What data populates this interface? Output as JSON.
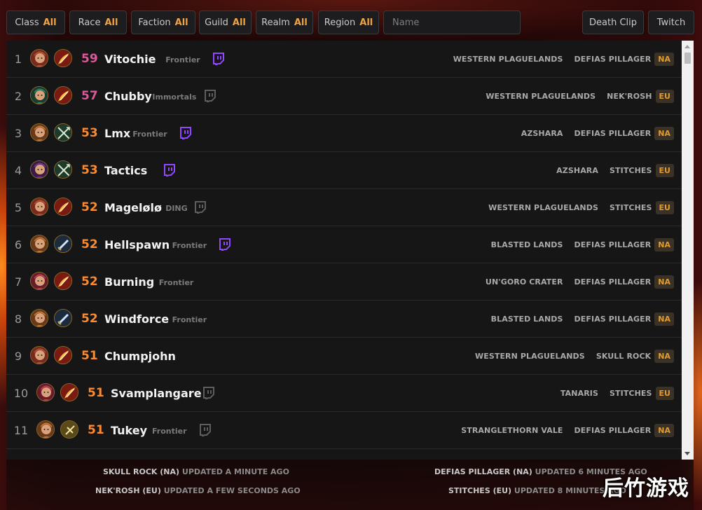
{
  "filters": {
    "class": {
      "label": "Class",
      "value": "All"
    },
    "race": {
      "label": "Race",
      "value": "All"
    },
    "faction": {
      "label": "Faction",
      "value": "All"
    },
    "guild": {
      "label": "Guild",
      "value": "All"
    },
    "realm": {
      "label": "Realm",
      "value": "All"
    },
    "region": {
      "label": "Region",
      "value": "All"
    },
    "name_placeholder": "Name",
    "death_clip": "Death Clip",
    "twitch": "Twitch"
  },
  "colors": {
    "accent": "#f2a33b",
    "level_high": "#e0569a",
    "level_mid": "#ff8a2b",
    "twitch_live": "#9146ff",
    "twitch_off": "#5e5e5e"
  },
  "rows": [
    {
      "rank": "1",
      "level": "59",
      "name": "Vitochie",
      "guild": "Frontier",
      "twitch": "live",
      "zone": "WESTERN PLAGUELANDS",
      "realm": "DEFIAS PILLAGER",
      "region": "NA"
    },
    {
      "rank": "2",
      "level": "57",
      "name": "Chubby",
      "guild": "Immortals",
      "twitch": "off",
      "zone": "WESTERN PLAGUELANDS",
      "realm": "NEK'ROSH",
      "region": "EU"
    },
    {
      "rank": "3",
      "level": "53",
      "name": "Lmx",
      "guild": "Frontier",
      "twitch": "live",
      "zone": "AZSHARA",
      "realm": "DEFIAS PILLAGER",
      "region": "NA"
    },
    {
      "rank": "4",
      "level": "53",
      "name": "Tactics",
      "guild": "",
      "twitch": "live",
      "zone": "AZSHARA",
      "realm": "STITCHES",
      "region": "EU"
    },
    {
      "rank": "5",
      "level": "52",
      "name": "Magelølø",
      "guild": "DING",
      "twitch": "off",
      "zone": "WESTERN PLAGUELANDS",
      "realm": "STITCHES",
      "region": "EU"
    },
    {
      "rank": "6",
      "level": "52",
      "name": "Hellspawn",
      "guild": "Frontier",
      "twitch": "live",
      "zone": "BLASTED LANDS",
      "realm": "DEFIAS PILLAGER",
      "region": "NA"
    },
    {
      "rank": "7",
      "level": "52",
      "name": "Burning",
      "guild": "Frontier",
      "twitch": "none",
      "zone": "UN'GORO CRATER",
      "realm": "DEFIAS PILLAGER",
      "region": "NA"
    },
    {
      "rank": "8",
      "level": "52",
      "name": "Windforce",
      "guild": "Frontier",
      "twitch": "none",
      "zone": "BLASTED LANDS",
      "realm": "DEFIAS PILLAGER",
      "region": "NA"
    },
    {
      "rank": "9",
      "level": "51",
      "name": "Chumpjohn",
      "guild": "",
      "twitch": "none",
      "zone": "WESTERN PLAGUELANDS",
      "realm": "SKULL ROCK",
      "region": "NA"
    },
    {
      "rank": "10",
      "level": "51",
      "name": "Svamplangare",
      "guild": "",
      "twitch": "off",
      "zone": "TANARIS",
      "realm": "STITCHES",
      "region": "EU"
    },
    {
      "rank": "11",
      "level": "51",
      "name": "Tukey",
      "guild": "Frontier",
      "twitch": "off",
      "zone": "STRANGLETHORN VALE",
      "realm": "DEFIAS PILLAGER",
      "region": "NA"
    }
  ],
  "footer": {
    "s1_realm": "SKULL ROCK (NA)",
    "s1_upd": "UPDATED A MINUTE AGO",
    "s2_realm": "DEFIAS PILLAGER (NA)",
    "s2_upd": "UPDATED 6 MINUTES AGO",
    "s3_realm": "NEK'ROSH (EU)",
    "s3_upd": "UPDATED A FEW SECONDS AGO",
    "s4_realm": "STITCHES (EU)",
    "s4_upd": "UPDATED 8 MINUTES AGO"
  },
  "watermark": "后竹游戏"
}
